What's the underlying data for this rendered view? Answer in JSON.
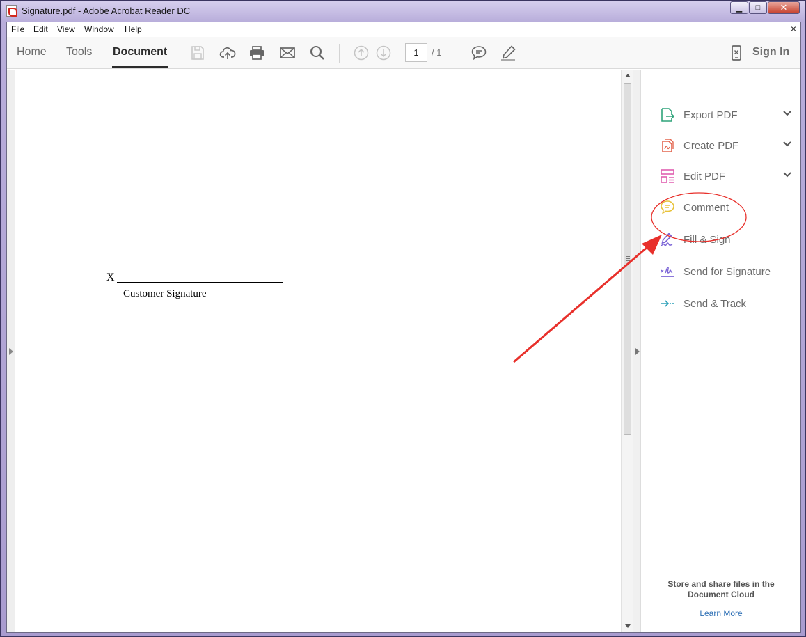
{
  "window": {
    "title": "Signature.pdf - Adobe Acrobat Reader DC",
    "minimize_glyph": "▁",
    "maximize_glyph": "□",
    "close_glyph": "✕"
  },
  "menu": {
    "items": [
      "File",
      "Edit",
      "View",
      "Window",
      "Help"
    ],
    "close_glyph": "×"
  },
  "toolbar": {
    "tabs": [
      "Home",
      "Tools",
      "Document"
    ],
    "active_tab": "Document",
    "icons": [
      "save-icon",
      "upload-cloud-icon",
      "print-icon",
      "email-icon",
      "search-icon",
      "page-up-icon",
      "page-down-icon",
      "comment-icon",
      "highlight-pen-icon",
      "mobile-icon"
    ],
    "page_current": "1",
    "page_total": "/ 1",
    "sign_in": "Sign In"
  },
  "document": {
    "x_mark": "X",
    "signature_label": "Customer Signature"
  },
  "tools_panel": {
    "items": [
      {
        "label": "Export PDF",
        "icon": "export-pdf-icon",
        "color": "#2fa37a",
        "expandable": true
      },
      {
        "label": "Create PDF",
        "icon": "create-pdf-icon",
        "color": "#e3664f",
        "expandable": true
      },
      {
        "label": "Edit PDF",
        "icon": "edit-pdf-icon",
        "color": "#e05fb0",
        "expandable": true
      },
      {
        "label": "Comment",
        "icon": "comment-icon",
        "color": "#e8c23a",
        "expandable": false
      },
      {
        "label": "Fill & Sign",
        "icon": "fill-sign-icon",
        "color": "#7b64d6",
        "expandable": false
      },
      {
        "label": "Send for Signature",
        "icon": "send-signature-icon",
        "color": "#7b64d6",
        "expandable": false
      },
      {
        "label": "Send & Track",
        "icon": "send-track-icon",
        "color": "#2a9fb8",
        "expandable": false
      }
    ],
    "cloud_text": "Store and share files in the Document Cloud",
    "learn_more": "Learn More"
  },
  "annotation": {
    "color": "#e8302b"
  }
}
